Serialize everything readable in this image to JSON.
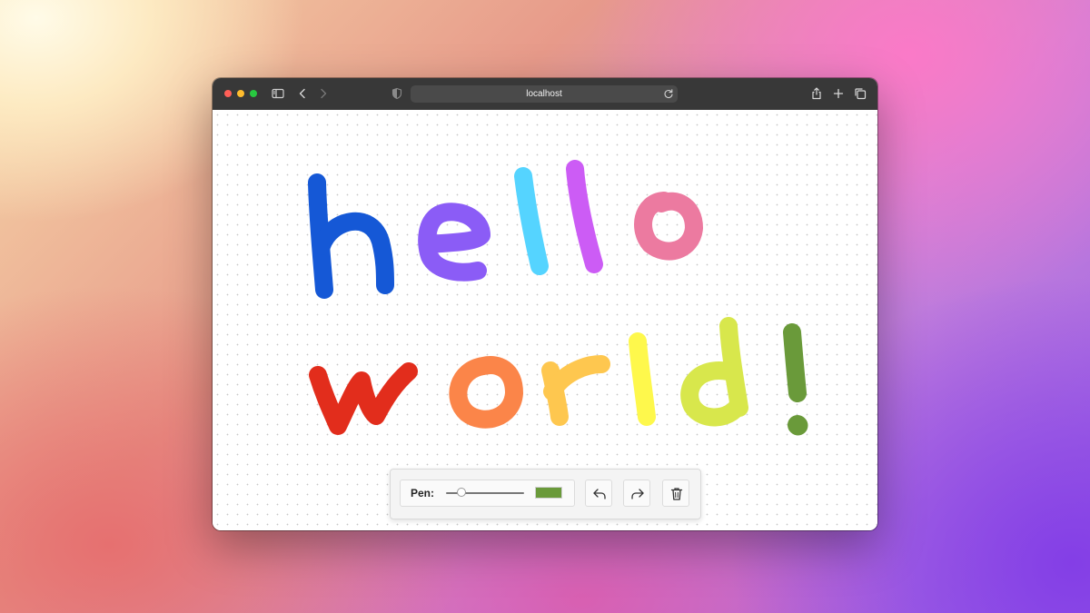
{
  "browser": {
    "address": "localhost"
  },
  "toolbar": {
    "pen_label": "Pen:",
    "pen_size": 0.2,
    "pen_color": "#6a9a3a"
  },
  "drawing": {
    "text_line_1": "hello",
    "text_line_2": "world!",
    "colors": [
      "#1558d6",
      "#8b5cf6",
      "#55d4ff",
      "#cc5cf5",
      "#ec7aa0",
      "#e22d1c",
      "#fb8549",
      "#fec74f",
      "#fef84c",
      "#d8e74c",
      "#6a9a3a"
    ]
  }
}
